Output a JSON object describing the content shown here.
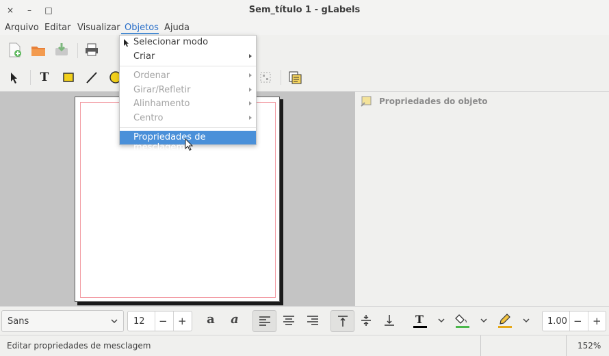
{
  "window": {
    "title": "Sem_título 1 - gLabels",
    "close_glyph": "×",
    "minimize_glyph": "–",
    "maximize_glyph": "□"
  },
  "menubar": {
    "items": [
      "Arquivo",
      "Editar",
      "Visualizar",
      "Objetos",
      "Ajuda"
    ],
    "active": "Objetos"
  },
  "toolbar_main": {
    "icons": [
      "new-file-icon",
      "open-folder-icon",
      "save-icon",
      "print-icon"
    ]
  },
  "toolbar_tools": {
    "icons": [
      "select-arrow-icon",
      "text-tool-icon",
      "box-tool-icon",
      "line-tool-icon",
      "ellipse-tool-icon",
      "image-tool-icon",
      "merge-properties-icon"
    ],
    "text_glyph": "T"
  },
  "objects_menu": {
    "items": [
      {
        "label": "Selecionar modo",
        "enabled": true,
        "submenu": false,
        "icon": "select-arrow-icon"
      },
      {
        "label": "Criar",
        "enabled": true,
        "submenu": true
      },
      {
        "label": "Ordenar",
        "enabled": false,
        "submenu": true
      },
      {
        "label": "Girar/Refletir",
        "enabled": false,
        "submenu": true
      },
      {
        "label": "Alinhamento",
        "enabled": false,
        "submenu": true
      },
      {
        "label": "Centro",
        "enabled": false,
        "submenu": true
      },
      {
        "label": "Propriedades de mesclagem",
        "enabled": true,
        "submenu": false,
        "highlighted": true
      }
    ]
  },
  "object_properties": {
    "title": "Propriedades do objeto"
  },
  "format_toolbar": {
    "font_family": "Sans",
    "font_size": "12",
    "minus": "−",
    "plus": "+",
    "line_width": "1.00",
    "bold_glyph": "a",
    "italic_glyph": "a",
    "text_color_glyph": "T",
    "colors": {
      "text": "#000000",
      "fill": "#4cb84c",
      "line": "#e6a817"
    }
  },
  "statusbar": {
    "message": "Editar propriedades de mesclagem",
    "zoom": "152%"
  },
  "colors": {
    "accent": "#4a90d9",
    "canvas_bg": "#c4c4c4",
    "label_margin": "#f29aa2"
  }
}
